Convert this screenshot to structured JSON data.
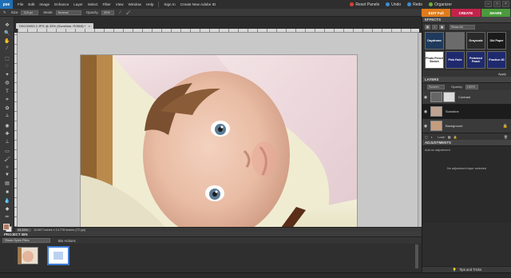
{
  "app": {
    "logo": "pse"
  },
  "menu": [
    "File",
    "Edit",
    "Image",
    "Enhance",
    "Layer",
    "Select",
    "Filter",
    "View",
    "Window",
    "Help"
  ],
  "account": {
    "sign_in": "Sign In",
    "create_id": "Create New Adobe ID"
  },
  "top_right": {
    "reset_panels": "Reset Panels",
    "undo": "Undo",
    "redo": "Redo",
    "organizer": "Organizer"
  },
  "options": {
    "size_label": "Size:",
    "size_value": "118 px",
    "mode_label": "Mode:",
    "mode_value": "Normal",
    "opacity_label": "Opacity:",
    "opacity_value": "20%"
  },
  "mode_tabs": {
    "edit": "EDIT Full",
    "create": "CREATE",
    "share": "SHARE"
  },
  "document": {
    "tab": "DSC00053 2.JPG @ 33% (Sunshine, RGB/8) *",
    "zoom": "33.33%",
    "info": "10.667 inches x 14.778 inches (72 ppi)"
  },
  "project_bin": {
    "title": "PROJECT BIN",
    "show": "Show Open Files",
    "actions": "Bin Actions"
  },
  "effects": {
    "title": "EFFECTS",
    "filter_value": "Show All",
    "tiles": [
      "Daydream",
      "",
      "Grayscale",
      "Old Paper",
      "Photo Pencil Sketch",
      "Pink Fade",
      "Polarized Peach",
      "Fraction 80"
    ],
    "apply": "Apply",
    "colors": {
      "accent": "#e07b1a",
      "create": "#c3234b",
      "share": "#4b9a3c"
    }
  },
  "layers": {
    "title": "LAYERS",
    "blend": "Screen",
    "opacity_label": "Opacity:",
    "opacity_value": "100%",
    "items": [
      {
        "name": "Contrast"
      },
      {
        "name": "Sunshine"
      },
      {
        "name": "Background"
      }
    ],
    "lock_label": "Lock:"
  },
  "adjustments": {
    "title": "ADJUSTMENTS",
    "add_label": "Add an adjustment",
    "none_label": "No adjustment layer selected"
  },
  "tips": {
    "label": "Tips and Tricks"
  }
}
